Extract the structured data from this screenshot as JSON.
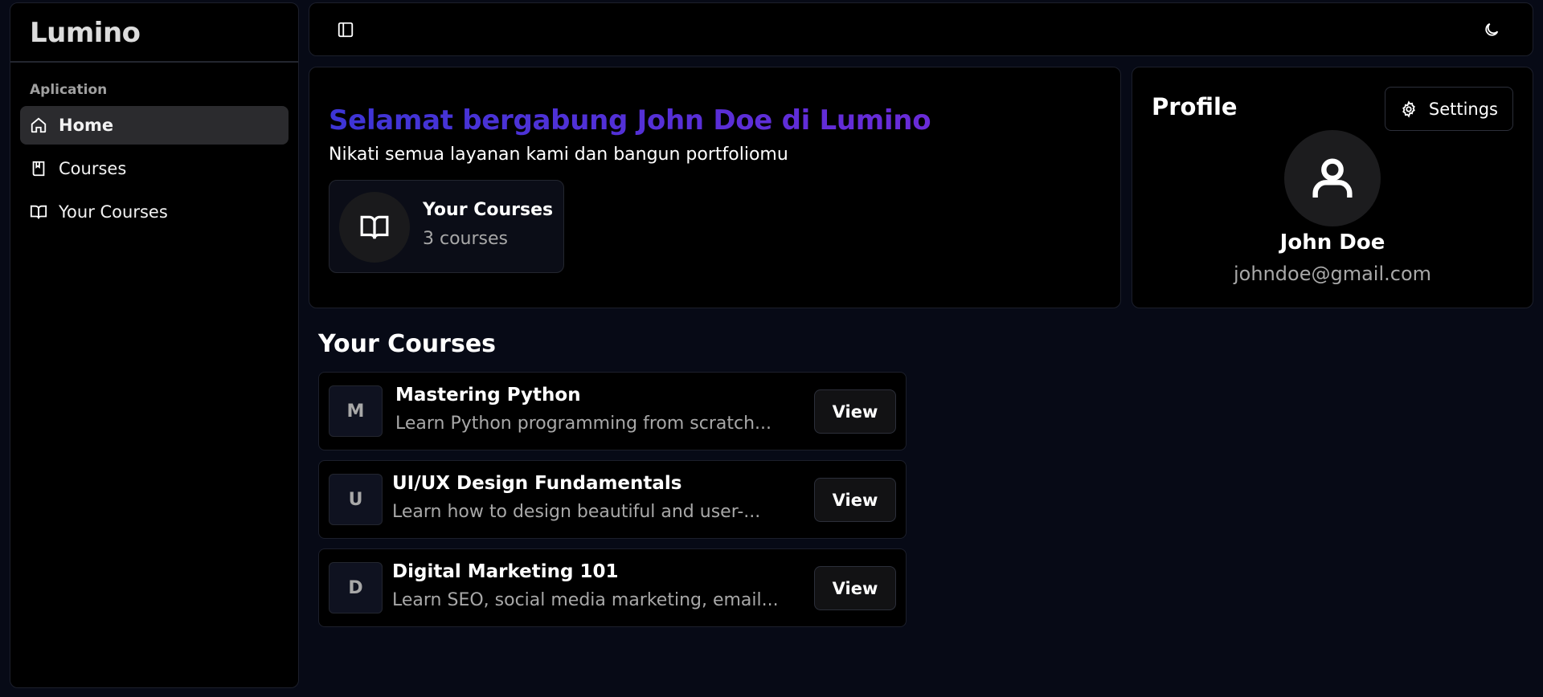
{
  "sidebar": {
    "logo": "Lumino",
    "group_label": "Aplication",
    "items": [
      {
        "label": "Home",
        "icon": "home-icon",
        "active": true
      },
      {
        "label": "Courses",
        "icon": "bookmark-book-icon",
        "active": false
      },
      {
        "label": "Your Courses",
        "icon": "book-open-icon",
        "active": false
      }
    ]
  },
  "topbar": {
    "left_icon": "sidebar-toggle-icon",
    "right_icon": "moon-icon"
  },
  "welcome": {
    "title": "Selamat bergabung John Doe di Lumino",
    "subtitle": "Nikati semua layanan kami dan bangun portfoliomu",
    "stat": {
      "title": "Your Courses",
      "value": "3 courses",
      "icon": "book-open-icon"
    }
  },
  "profile": {
    "title": "Profile",
    "settings_label": "Settings",
    "name": "John Doe",
    "email": "johndoe@gmail.com"
  },
  "courses_section": {
    "title": "Your Courses",
    "items": [
      {
        "letter": "M",
        "title": "Mastering Python",
        "description": "Learn Python programming from scratch...",
        "button": "View"
      },
      {
        "letter": "U",
        "title": "UI/UX Design Fundamentals",
        "description": "Learn how to design beautiful and user-...",
        "button": "View"
      },
      {
        "letter": "D",
        "title": "Digital Marketing 101",
        "description": "Learn SEO, social media marketing, email...",
        "button": "View"
      }
    ]
  },
  "colors": {
    "background": "#070a16",
    "panel": "#000000",
    "gradient_start": "#3d35d6",
    "gradient_end": "#6a2bd8",
    "muted_text": "#a8a8a8"
  }
}
